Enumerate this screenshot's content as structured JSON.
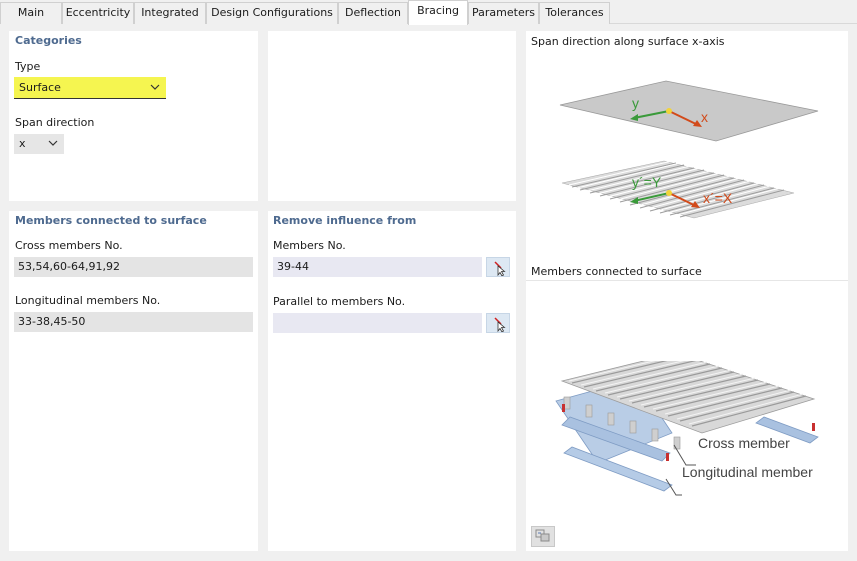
{
  "tabs": [
    "Main",
    "Eccentricity",
    "Integrated",
    "Design Configurations",
    "Deflection",
    "Bracing",
    "Parameters",
    "Tolerances"
  ],
  "active_tab": "Bracing",
  "categories": {
    "title": "Categories",
    "type_label": "Type",
    "type_value": "Surface",
    "span_label": "Span direction",
    "span_value": "x"
  },
  "members_connected": {
    "title": "Members connected to surface",
    "cross_label": "Cross members No.",
    "cross_value": "53,54,60-64,91,92",
    "long_label": "Longitudinal members No.",
    "long_value": "33-38,45-50"
  },
  "remove_influence": {
    "title": "Remove influence from",
    "members_label": "Members No.",
    "members_value": "39-44",
    "parallel_label": "Parallel to members No.",
    "parallel_value": ""
  },
  "images": {
    "span_title": "Span direction along surface x-axis",
    "axis_y": "y",
    "axis_x": "x",
    "axis_y2": "y´=Y",
    "axis_x2": "x´=X",
    "members_title": "Members connected to surface",
    "cross_member": "Cross member",
    "long_member": "Longitudinal member"
  },
  "colors": {
    "section_title": "#4e6a8f",
    "highlight": "#f5f550",
    "axis_green": "#3a9a3a",
    "axis_red": "#d24a1a"
  }
}
